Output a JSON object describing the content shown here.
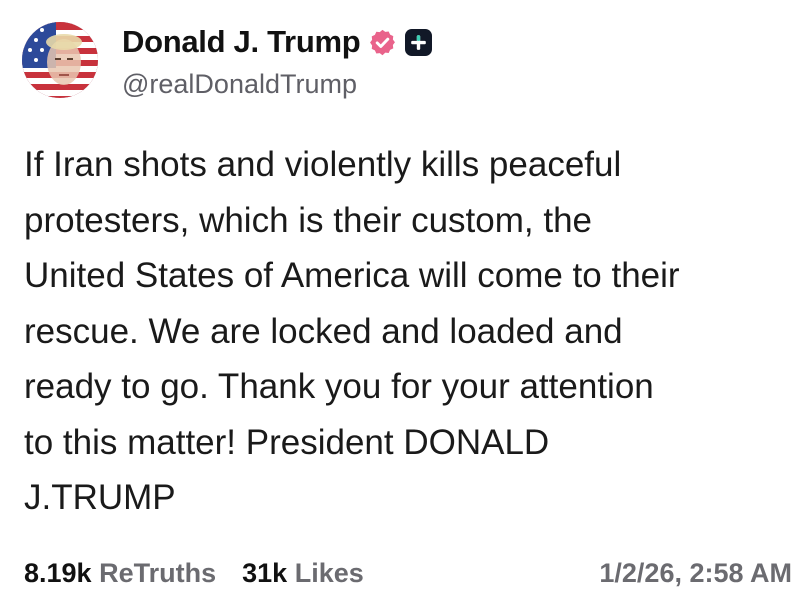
{
  "author": {
    "display_name": "Donald J. Trump",
    "handle": "@realDonaldTrump",
    "verified_badge_color": "#e9638b",
    "avatar_icon": "avatar-flag-portrait"
  },
  "post": {
    "lines": [
      "If Iran shots and violently kills peaceful",
      "protesters, which is their custom, the",
      "United States of America will come to their",
      "rescue. We are locked and loaded and",
      "ready to go. Thank you for your attention",
      "to this matter! President DONALD",
      "J.TRUMP"
    ]
  },
  "stats": {
    "retruths_count": "8.19k",
    "retruths_label": "ReTruths",
    "likes_count": "31k",
    "likes_label": "Likes"
  },
  "timestamp": "1/2/26, 2:58 AM"
}
